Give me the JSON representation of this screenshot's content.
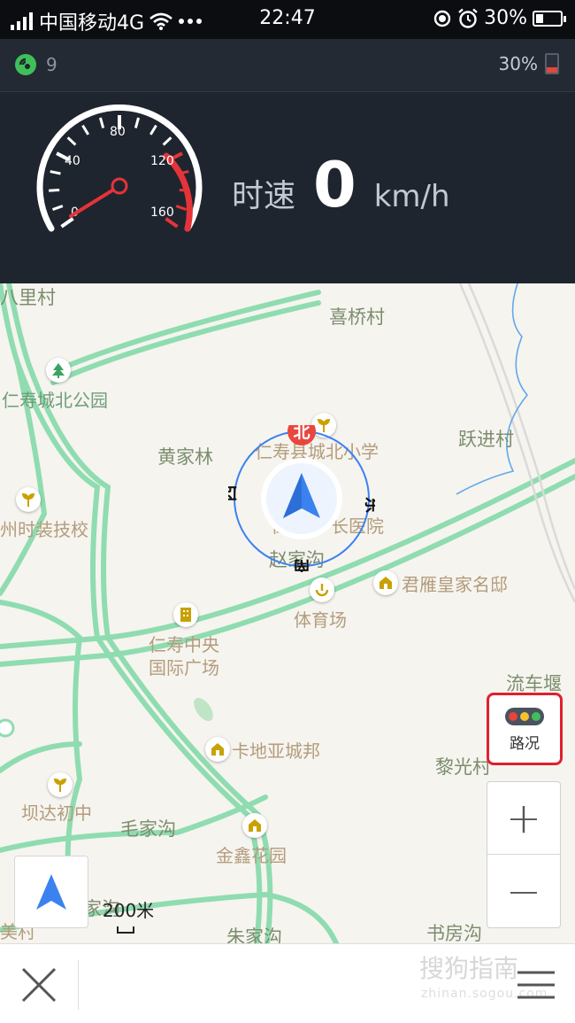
{
  "status_bar": {
    "carrier": "中国移动4G",
    "time": "22:47",
    "battery_percent": "30%",
    "battery_level": 0.3
  },
  "info_bar": {
    "satellite_count": "9",
    "battery_percent": "30%"
  },
  "speedometer": {
    "ticks": [
      "0",
      "40",
      "80",
      "120",
      "160"
    ],
    "label": "时速",
    "value": "0",
    "unit": "km/h"
  },
  "map": {
    "villages": {
      "xiqiao": "喜桥村",
      "huangjialin": "黄家林",
      "yuejin": "跃进村",
      "liuchewei": "流车堰",
      "liguang": "黎光村",
      "maojiagou": "毛家沟",
      "zhujiagou": "朱家沟",
      "shufanggou": "书房沟",
      "lili": "八里村",
      "zhaojiagou": "赵家沟",
      "jia_partial": "家沟"
    },
    "pois": {
      "park": "仁寿城北公园",
      "school": "仁寿县城北小学",
      "hospital": "长医院",
      "hospital_prefix": "仁",
      "trade_school": "州时装技校",
      "stadium": "体育场",
      "mansion": "君雁皇家名邸",
      "plaza_line1": "仁寿中央",
      "plaza_line2": "国际广场",
      "kadiya": "卡地亚城邦",
      "baida": "坝达初中",
      "jinxin": "金鑫花园",
      "left_partial": "美村"
    },
    "compass": {
      "north": "北",
      "south": "南",
      "east": "东",
      "west": "西"
    },
    "traffic_label": "路况",
    "zoom_in": "+",
    "zoom_out": "−",
    "scale": "200米"
  },
  "bottom_bar": {
    "watermark": "搜狗指南",
    "watermark_sub": "zhinan.sogou.com"
  },
  "colors": {
    "panel": "#1f252e",
    "road": "#8fdcb0",
    "accent_blue": "#3b82f0",
    "north_red": "#e8473f",
    "traffic_border": "#e0202e"
  }
}
